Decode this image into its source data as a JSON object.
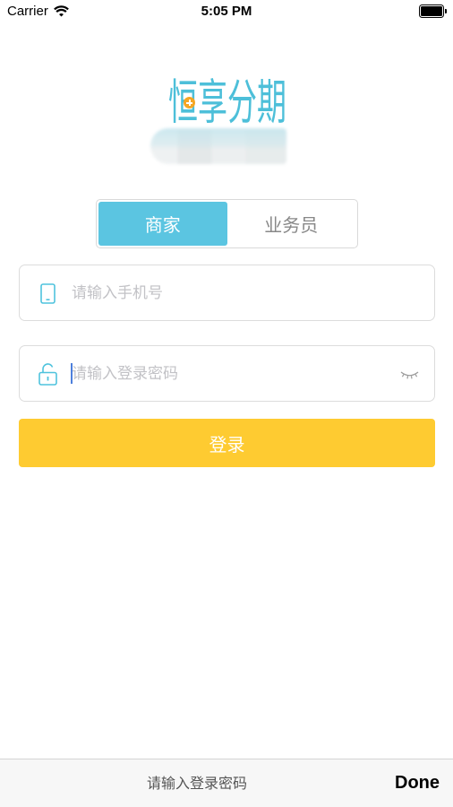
{
  "status_bar": {
    "carrier": "Carrier",
    "time": "5:05 PM",
    "battery_level": 1.0,
    "icons": [
      "wifi-icon",
      "battery-icon"
    ]
  },
  "logo": {
    "text": "恒享分期",
    "color": "#4dbfd9",
    "accent_color": "#f5a623"
  },
  "role_switch": {
    "selected_index": 0,
    "items": [
      {
        "label": "商家"
      },
      {
        "label": "业务员"
      }
    ],
    "active_color": "#5bc5e1",
    "inactive_text_color": "#888888"
  },
  "phone_field": {
    "icon": "phone-icon",
    "placeholder": "请输入手机号",
    "value": ""
  },
  "password_field": {
    "icon": "unlock-icon",
    "placeholder": "请输入登录密码",
    "value": "",
    "toggle_icon": "eye-closed-icon"
  },
  "login_button": {
    "label": "登录",
    "color": "#fecb31"
  },
  "keyboard_toolbar": {
    "hint": "请输入登录密码",
    "done_label": "Done"
  },
  "theme": {
    "icon_color": "#4fc3dd"
  }
}
